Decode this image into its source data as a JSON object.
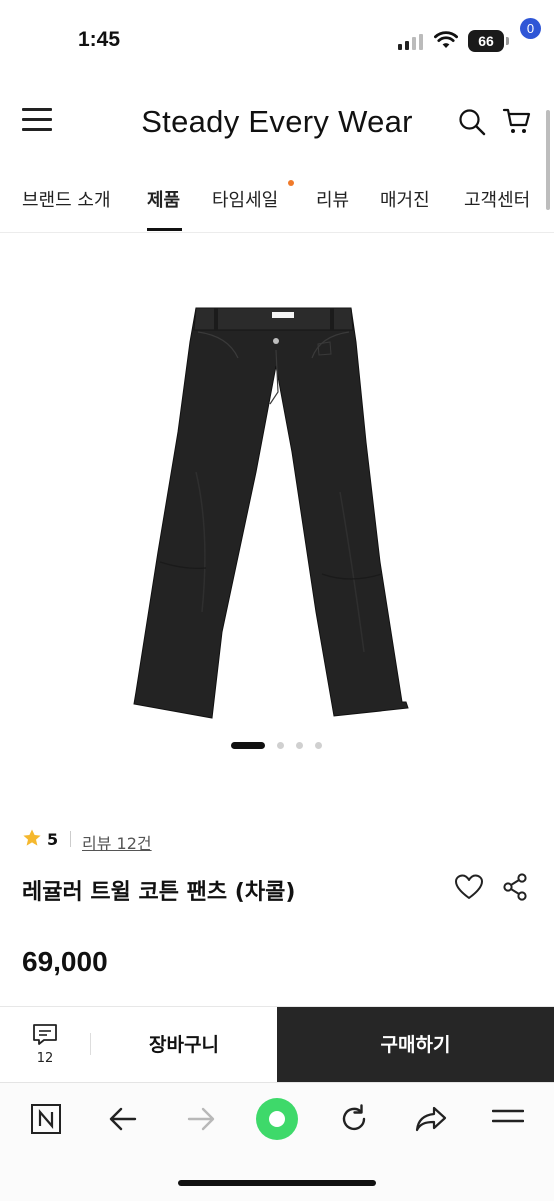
{
  "status": {
    "time": "1:45",
    "battery": "66"
  },
  "header": {
    "brand": "Steady Every Wear",
    "cart_count": "0"
  },
  "nav": {
    "items": [
      {
        "label": "브랜드 소개"
      },
      {
        "label": "제품"
      },
      {
        "label": "타임세일"
      },
      {
        "label": "리뷰"
      },
      {
        "label": "매거진"
      },
      {
        "label": "고객센터"
      }
    ],
    "active_index": 1
  },
  "product": {
    "rating": "5",
    "review_link": "리뷰 12건",
    "title": "레귤러 트윌 코튼 팬츠 (차콜)",
    "price": "69,000",
    "image_count": 4,
    "image_index": 0
  },
  "action_bar": {
    "chat_count": "12",
    "cart_label": "장바구니",
    "buy_label": "구매하기"
  },
  "colors": {
    "accent_dot": "#f07a2a",
    "badge": "#2f56d6",
    "buy_button": "#262626",
    "browser_green": "#3ed96a"
  },
  "browser": {
    "icons": [
      "naver-n-icon",
      "back-arrow-icon",
      "forward-arrow-icon",
      "green-dot-icon",
      "refresh-icon",
      "share-arrow-icon",
      "menu-icon"
    ]
  }
}
